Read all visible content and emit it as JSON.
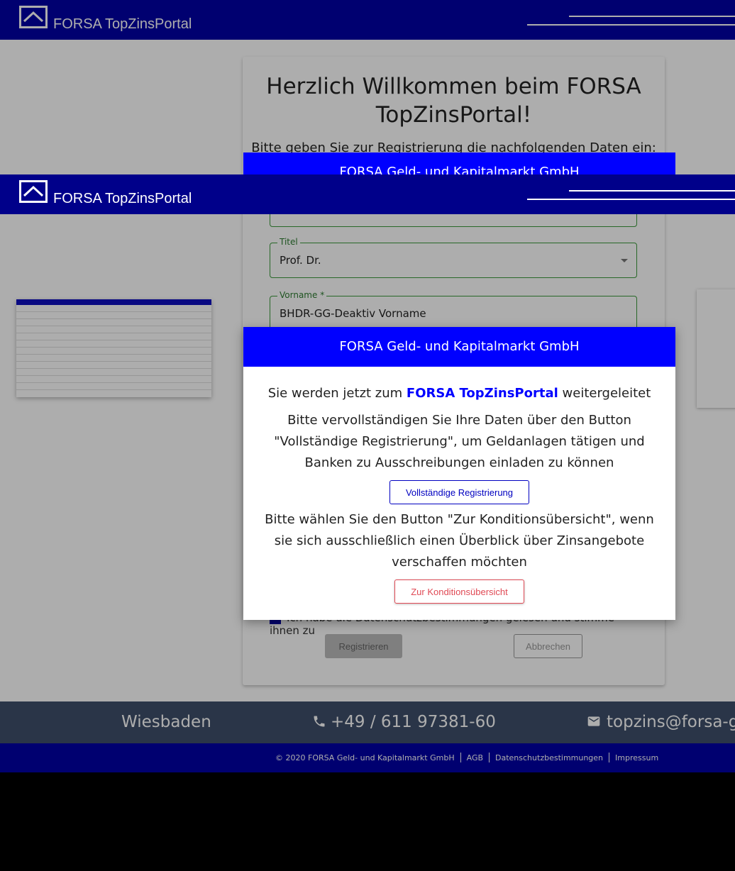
{
  "header": {
    "logo_text": "FORSA TopZinsPortal"
  },
  "card": {
    "title": "Herzlich Willkommen beim FORSA TopZinsPortal!",
    "intro": "Bitte geben Sie zur Registrierung die nachfolgenden Daten ein:",
    "fields": {
      "titel": {
        "label": "Titel",
        "value": "Prof. Dr."
      },
      "vorname": {
        "label": "Vorname *",
        "value": "BHDR-GG-Deaktiv Vorname"
      }
    },
    "consent_text": "Ich habe die Datenschutzbestimmungen gelesen und stimme ihnen zu",
    "register_label": "Registrieren",
    "cancel_label": "Abbrechen"
  },
  "contact": {
    "city": "Wiesbaden",
    "phone": "+49 / 611 97381-60",
    "email": "topzins@forsa-gmbh.de"
  },
  "footer": {
    "copyright": "© 2020 FORSA Geld- und Kapitalmarkt GmbH",
    "agb": "AGB",
    "privacy": "Datenschutzbestimmungen",
    "imprint": "Impressum"
  },
  "dialog": {
    "title": "FORSA Geld- und Kapitalmarkt GmbH",
    "line1_pre": "Sie werden jetzt zum ",
    "line1_accent": "FORSA TopZinsPortal",
    "line1_post": " weitergeleitet",
    "para2": "Bitte vervollständigen Sie Ihre Daten über den Button \"Vollständige Registrierung\", um Geldanlagen tätigen und Banken zu Ausschreibungen einladen zu können",
    "full_registration_label": "Vollständige Registrierung",
    "para3": "Bitte wählen Sie den Button \"Zur Konditionsübersicht\", wenn sie sich ausschließlich einen Überblick über Zinsangebote verschaffen möchten",
    "conditions_label": "Zur Konditionsübersicht"
  },
  "colors": {
    "header": "#0000a5",
    "dialog_header": "#0000ff",
    "accent_red": "#e04a55",
    "contact_bar": "#3f4f6b"
  }
}
